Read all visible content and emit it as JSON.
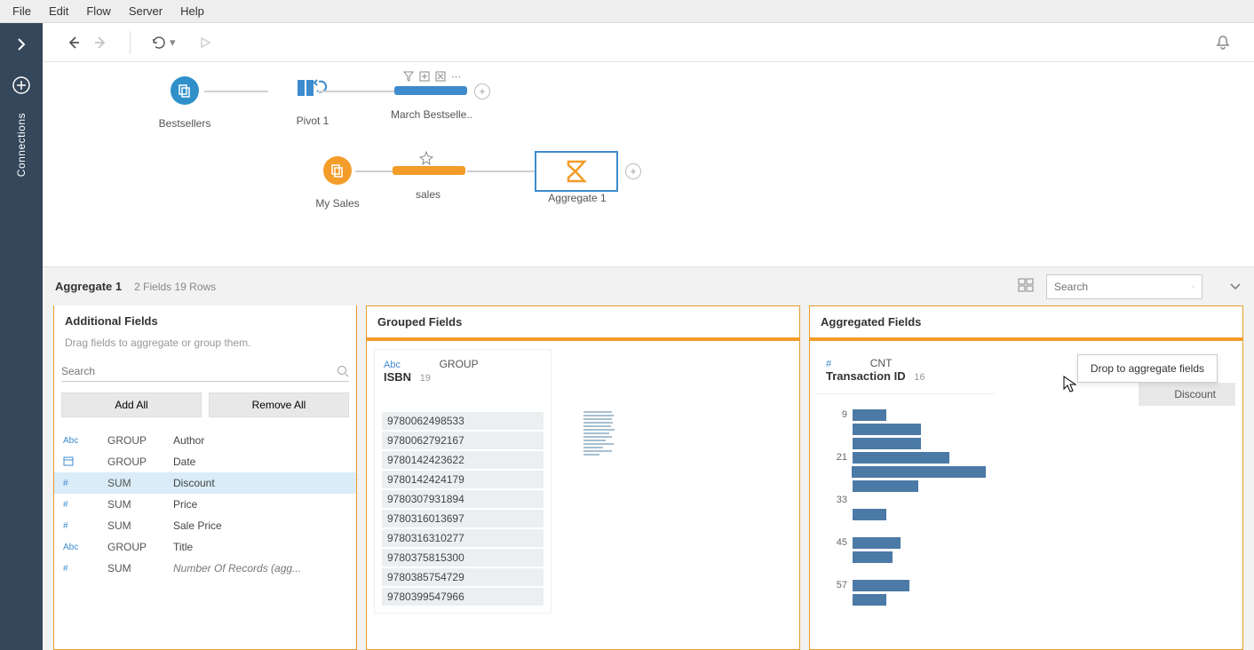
{
  "menubar": [
    "File",
    "Edit",
    "Flow",
    "Server",
    "Help"
  ],
  "sidebar": {
    "label": "Connections"
  },
  "flow": {
    "nodes": {
      "bestsellers": "Bestsellers",
      "pivot": "Pivot 1",
      "march": "March Bestselle..",
      "mysales": "My Sales",
      "sales": "sales",
      "aggregate": "Aggregate 1"
    }
  },
  "bottom": {
    "title": "Aggregate 1",
    "status": "2 Fields   19 Rows",
    "search_placeholder": "Search"
  },
  "additional": {
    "title": "Additional Fields",
    "helper": "Drag fields to aggregate or group them.",
    "search_placeholder": "Search",
    "add_all": "Add All",
    "remove_all": "Remove All",
    "fields": [
      {
        "type": "Abc",
        "fn": "GROUP",
        "name": "Author"
      },
      {
        "type": "date",
        "fn": "GROUP",
        "name": "Date"
      },
      {
        "type": "#",
        "fn": "SUM",
        "name": "Discount",
        "selected": true
      },
      {
        "type": "#",
        "fn": "SUM",
        "name": "Price"
      },
      {
        "type": "#",
        "fn": "SUM",
        "name": "Sale Price"
      },
      {
        "type": "Abc",
        "fn": "GROUP",
        "name": "Title"
      },
      {
        "type": "#",
        "fn": "SUM",
        "name": "Number Of Records (agg...",
        "italic": true
      }
    ]
  },
  "grouped": {
    "title": "Grouped Fields",
    "card": {
      "type": "Abc",
      "fn": "GROUP",
      "field": "ISBN",
      "count": "19",
      "values": [
        "9780062498533",
        "9780062792167",
        "9780142423622",
        "9780142424179",
        "9780307931894",
        "9780316013697",
        "9780316310277",
        "9780375815300",
        "9780385754729",
        "9780399547966"
      ]
    }
  },
  "aggregated": {
    "title": "Aggregated Fields",
    "card": {
      "type": "#",
      "fn": "CNT",
      "field": "Transaction ID",
      "count": "16"
    },
    "drop_hint": "Drop to aggregate fields",
    "drag_label": "Discount"
  },
  "chart_data": {
    "type": "bar",
    "orientation": "horizontal",
    "title": "",
    "xlabel": "",
    "ylabel": "",
    "y_ticks": [
      9,
      21,
      33,
      45,
      57
    ],
    "categories": [
      "9",
      "",
      "",
      "21",
      "",
      "",
      "33",
      "",
      "",
      "45",
      "",
      "",
      "57",
      "",
      ""
    ],
    "values": [
      24,
      48,
      48,
      68,
      100,
      46,
      0,
      24,
      0,
      34,
      28,
      0,
      40,
      24,
      0
    ]
  }
}
